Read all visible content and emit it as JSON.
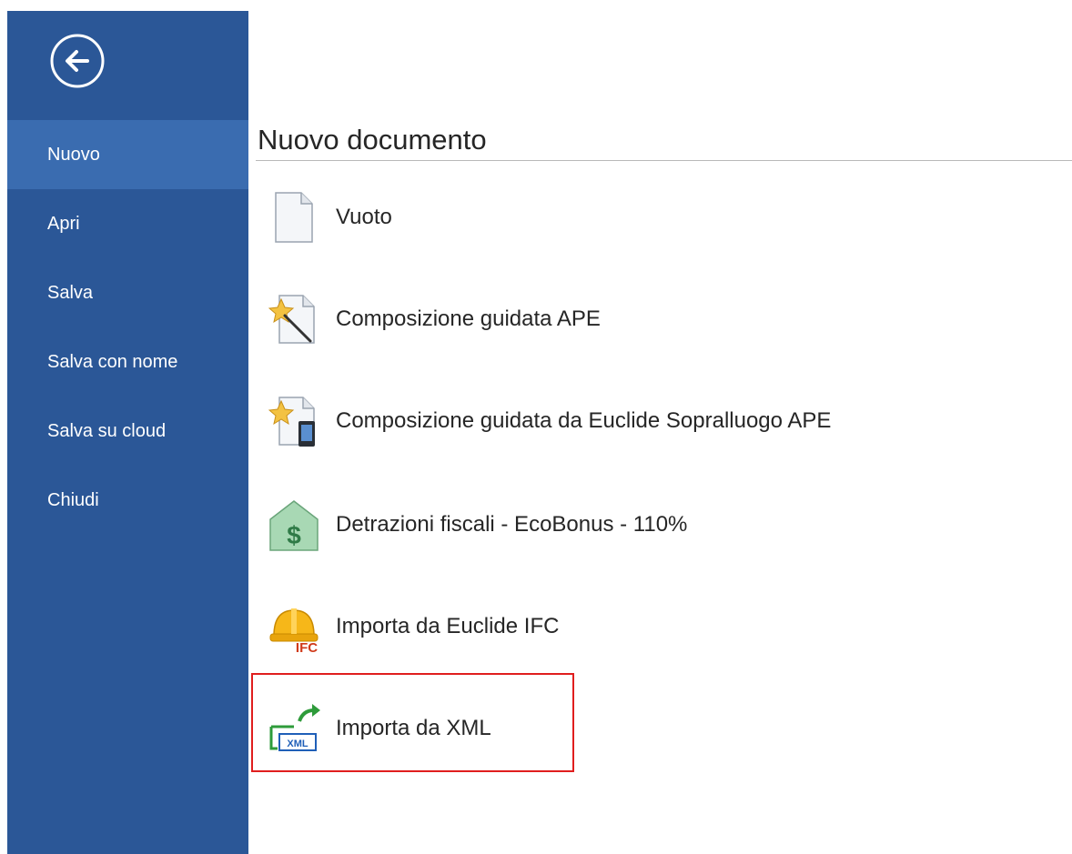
{
  "sidebar": {
    "back_icon": "back-arrow-circle-icon",
    "items": [
      {
        "label": "Nuovo",
        "active": true
      },
      {
        "label": "Apri",
        "active": false
      },
      {
        "label": "Salva",
        "active": false
      },
      {
        "label": "Salva con nome",
        "active": false
      },
      {
        "label": "Salva su cloud",
        "active": false
      },
      {
        "label": "Chiudi",
        "active": false
      }
    ]
  },
  "main": {
    "title": "Nuovo documento",
    "options": [
      {
        "label": "Vuoto",
        "icon": "blank-document-icon"
      },
      {
        "label": "Composizione guidata APE",
        "icon": "wizard-document-icon"
      },
      {
        "label": "Composizione guidata da Euclide Sopralluogo APE",
        "icon": "wizard-mobile-icon"
      },
      {
        "label": "Detrazioni fiscali - EcoBonus - 110%",
        "icon": "house-dollar-icon"
      },
      {
        "label": "Importa da Euclide IFC",
        "icon": "hardhat-ifc-icon",
        "icon_text": "IFC"
      },
      {
        "label": "Importa da XML",
        "icon": "xml-import-icon",
        "icon_text": "XML"
      }
    ]
  },
  "colors": {
    "sidebar_bg": "#2b5797",
    "sidebar_active": "#3a6cb0",
    "highlight_border": "#e01e1e"
  }
}
